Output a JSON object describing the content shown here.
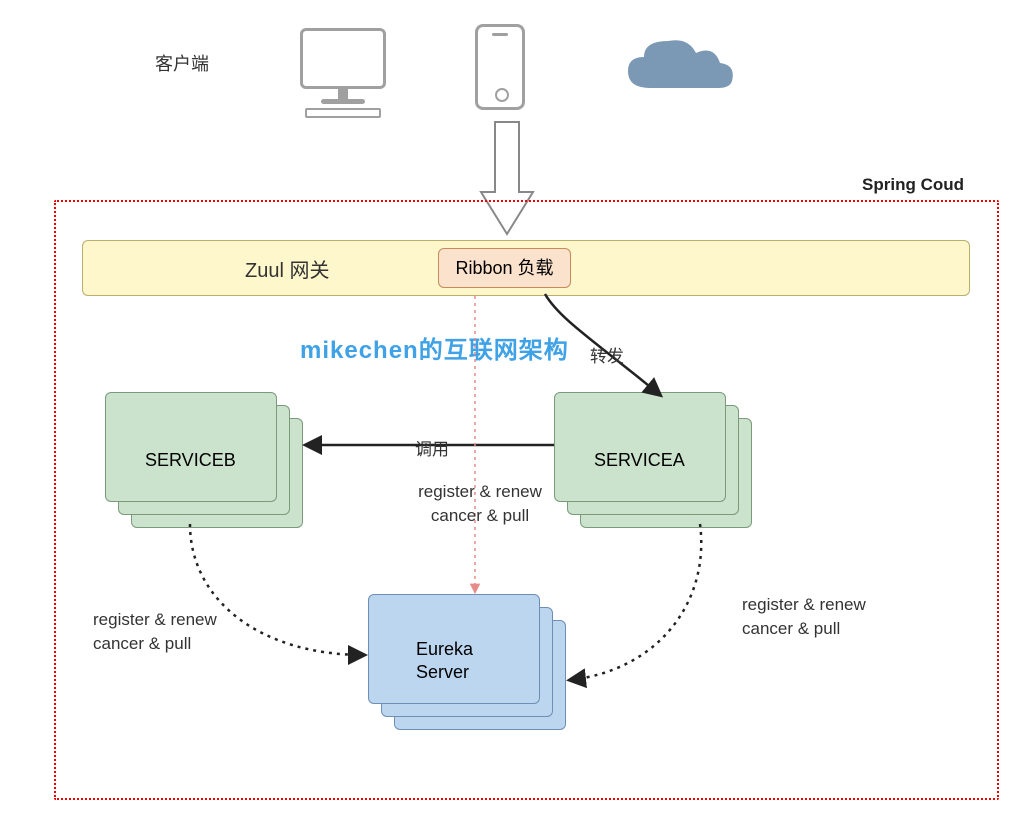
{
  "header": {
    "client_label": "客户端",
    "frame_title": "Spring Coud"
  },
  "watermark": "mikechen的互联网架构",
  "gateway": {
    "zuul_label": "Zuul 网关",
    "ribbon_label": "Ribbon 负载"
  },
  "services": {
    "a": "SERVICEA",
    "b": "SERVICEB",
    "eureka": "Eureka\nServer"
  },
  "labels": {
    "forward": "转发",
    "call": "调用",
    "register_renew_line1": "register & renew",
    "register_renew_line2": "cancer & pull"
  },
  "icons": {
    "desktop": "desktop-icon",
    "phone": "phone-icon",
    "cloud": "cloud-icon",
    "down_arrow": "down-arrow-icon"
  }
}
